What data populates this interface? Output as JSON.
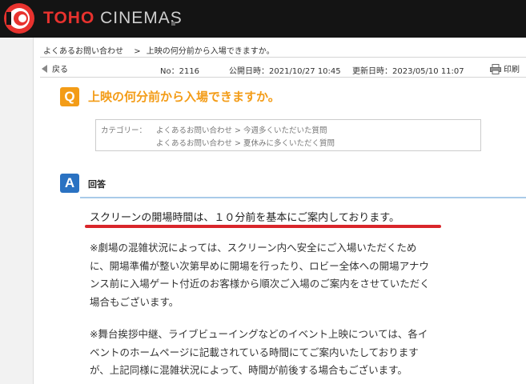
{
  "header": {
    "logo_toho": "TOHO",
    "logo_cinemas": " CINEMAS"
  },
  "breadcrumb": {
    "home": "よくあるお問い合わせ",
    "separator": ">",
    "current": "上映の何分前から入場できますか。"
  },
  "toolbar": {
    "back_label": "戻る",
    "faq_no": "No：2116",
    "published": "公開日時：2021/10/27 10:45",
    "updated": "更新日時：2023/05/10 11:07",
    "print_label": "印刷"
  },
  "question": {
    "icon_letter": "Q",
    "title": "上映の何分前から入場できますか。"
  },
  "categories": {
    "label": "カテゴリー：",
    "items": [
      "よくあるお問い合わせ > 今週多くいただいた質問",
      "よくあるお問い合わせ > 夏休みに多くいただく質問"
    ]
  },
  "answer": {
    "icon_letter": "A",
    "heading": "回答",
    "main": "スクリーンの開場時間は、１０分前を基本にご案内しております。",
    "paragraph1": [
      "※劇場の混雑状況によっては、スクリーン内へ安全にご入場いただくため",
      "に、開場準備が整い次第早めに開場を行ったり、ロビー全体への開場アナウ",
      "ンス前に入場ゲート付近のお客様から順次ご入場のご案内をさせていただく",
      "場合もございます。"
    ],
    "paragraph2": [
      "※舞台挨拶中継、ライブビューイングなどのイベント上映については、各イ",
      "ベントのホームページに記載されている時間にてご案内いたしております",
      "が、上記同様に混雑状況によって、時間が前後する場合もございます。"
    ]
  },
  "colors": {
    "header_bg": "#141414",
    "brand_red": "#e8322e",
    "question_orange": "#f39c17",
    "answer_blue": "#2a72c2",
    "highlight_red": "#d9262b"
  }
}
